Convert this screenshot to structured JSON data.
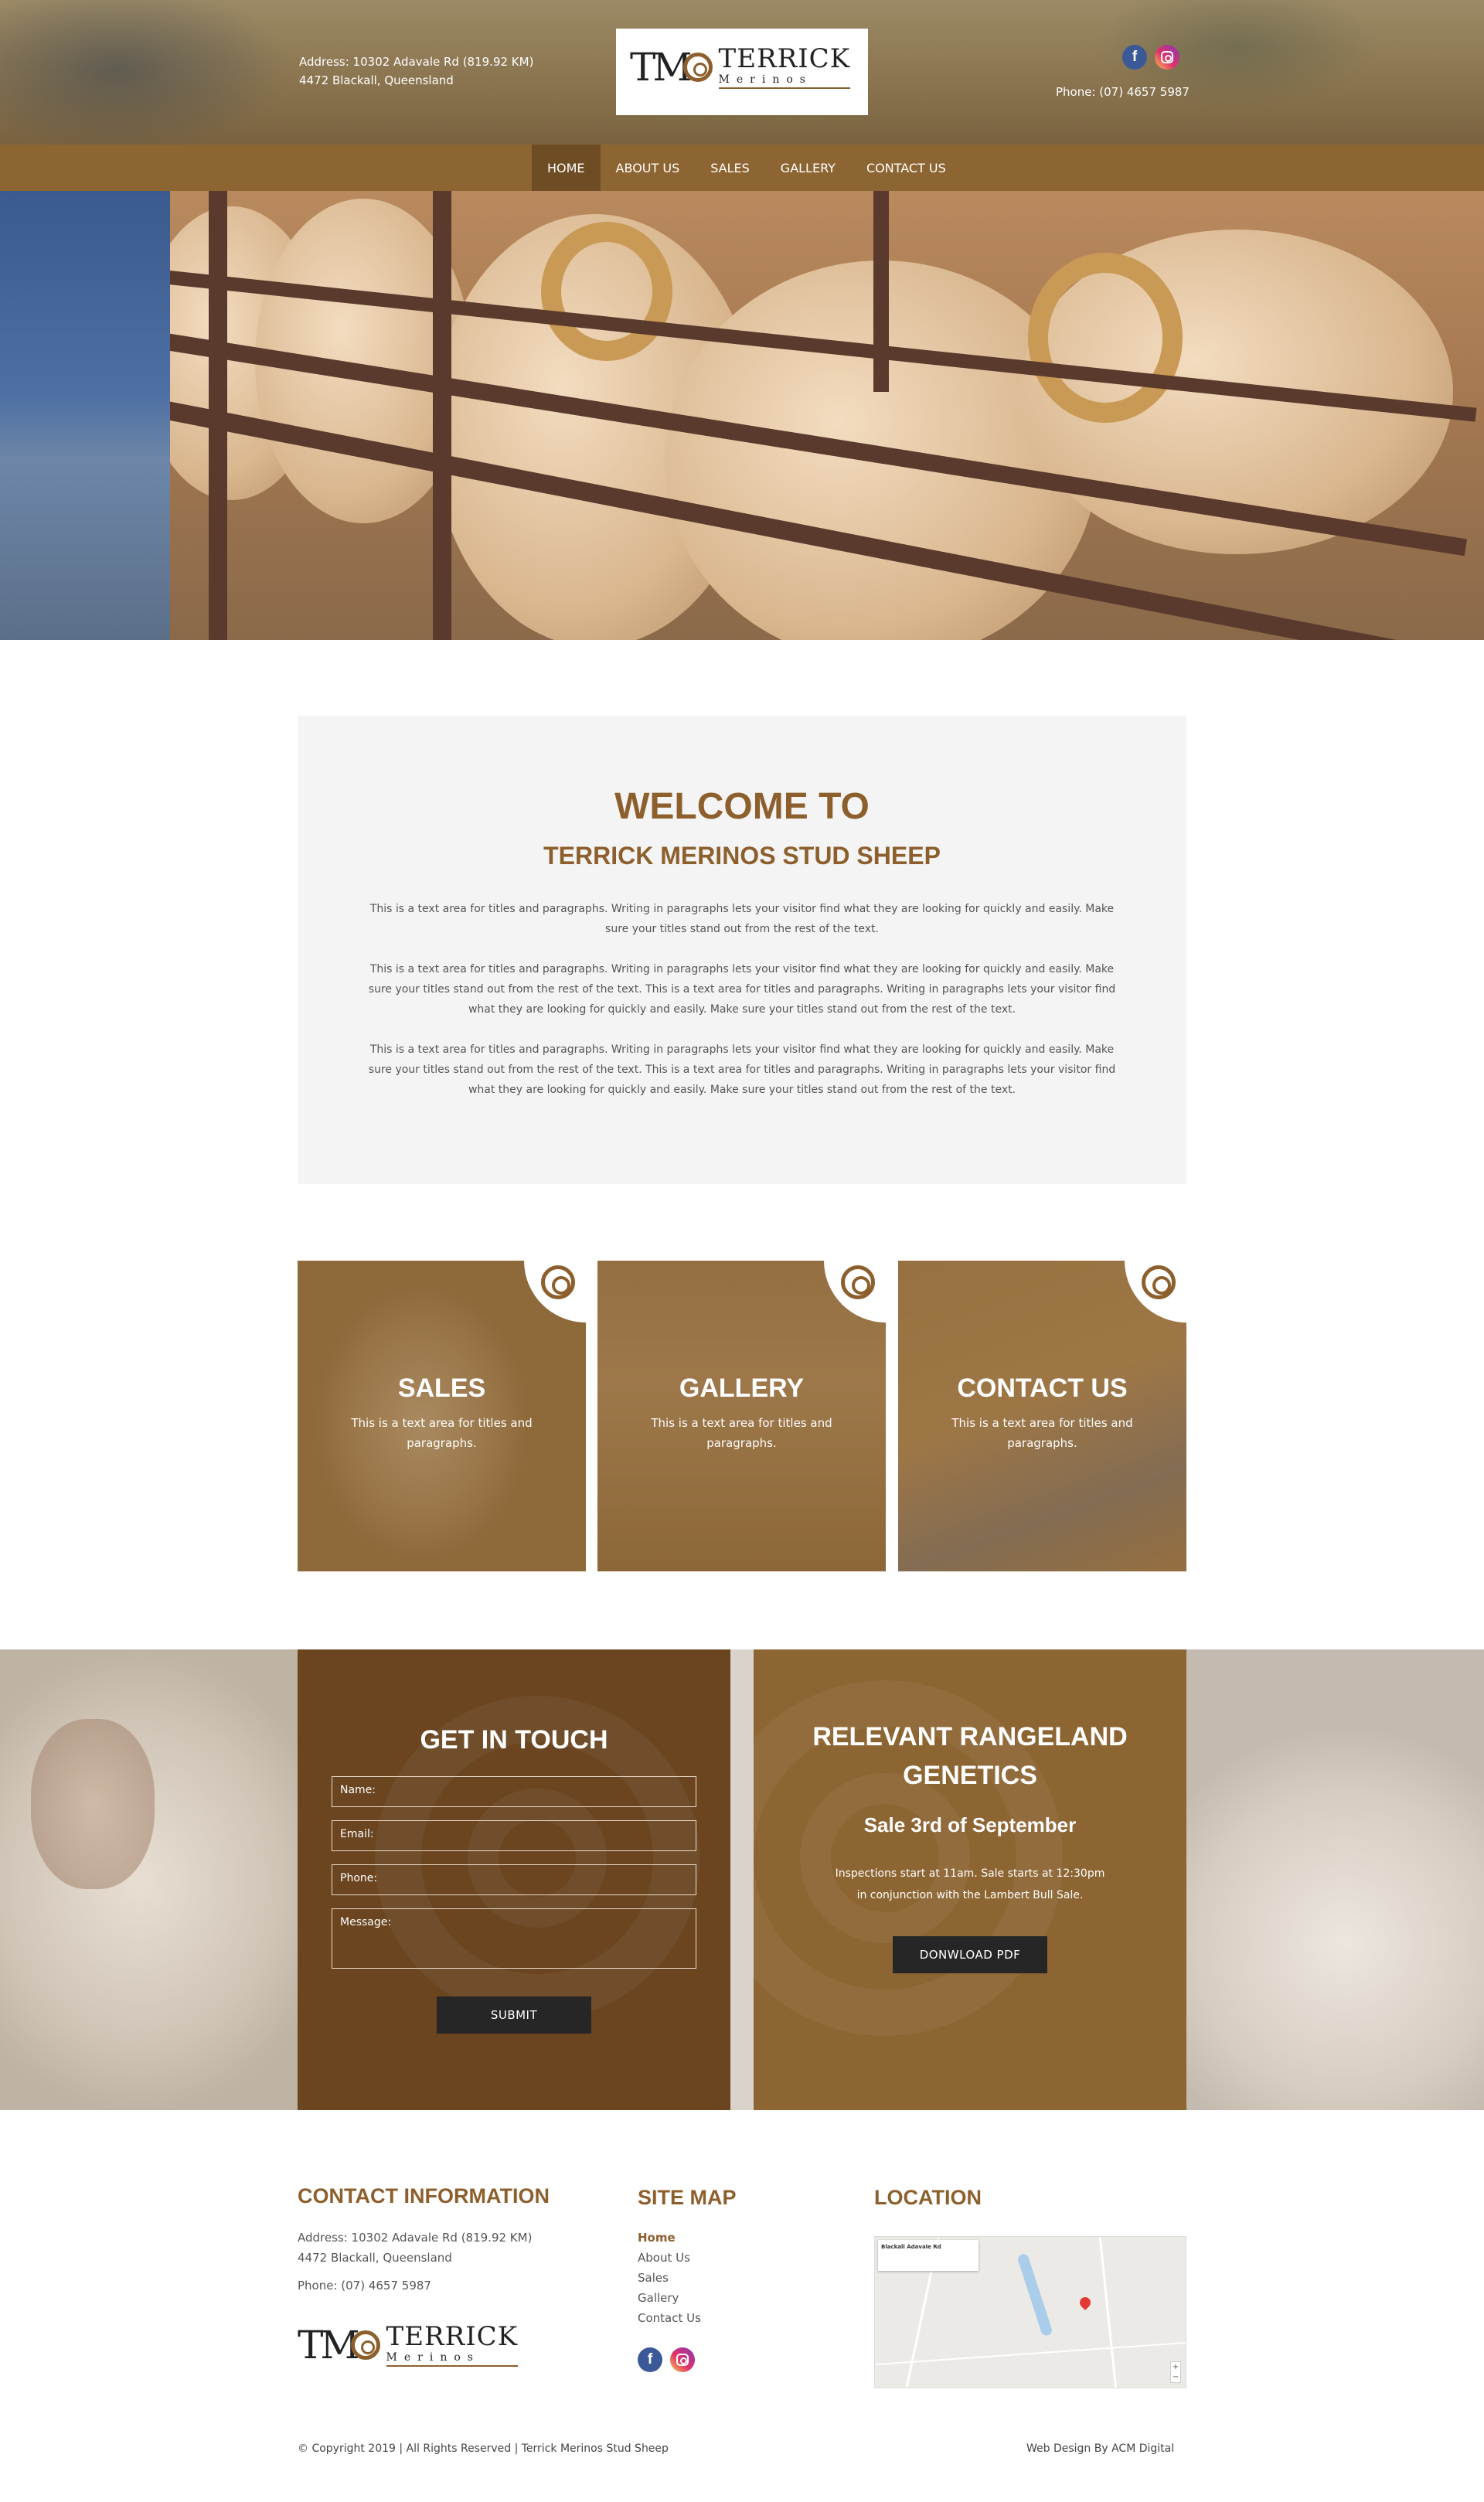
{
  "header": {
    "address_line1": "Address: 10302 Adavale Rd (819.92 KM)",
    "address_line2": "4472 Blackall, Queensland",
    "logo_mark": "TM",
    "logo_word1": "TERRICK",
    "logo_word2": "Merinos",
    "phone": "Phone: (07) 4657 5987",
    "social": [
      "facebook-icon",
      "instagram-icon"
    ]
  },
  "nav": {
    "items": [
      {
        "label": "HOME",
        "active": true
      },
      {
        "label": "ABOUT US"
      },
      {
        "label": "SALES"
      },
      {
        "label": "GALLERY"
      },
      {
        "label": "CONTACT US"
      }
    ]
  },
  "welcome": {
    "title": "WELCOME TO",
    "subtitle": "TERRICK MERINOS STUD SHEEP",
    "paragraphs": [
      "This is a text area for titles and paragraphs. Writing in paragraphs lets your visitor find what they are looking for quickly and easily. Make sure your titles stand out from the rest of the text.",
      "This is a text area for titles and paragraphs. Writing in paragraphs lets your visitor find what they are looking for quickly and easily. Make sure your titles stand out from the rest of the text. This is a text area for titles and paragraphs. Writing in paragraphs lets your visitor find what they are looking for quickly and easily. Make sure your titles stand out from the rest of the text.",
      "This is a text area for titles and paragraphs. Writing in paragraphs lets your visitor find what they are looking for quickly and easily. Make sure your titles stand out from the rest of the text. This is a text area for titles and paragraphs. Writing in paragraphs lets your visitor find what they are looking for quickly and easily. Make sure your titles stand out from the rest of the text."
    ]
  },
  "cards": [
    {
      "title": "SALES",
      "text": "This is a text area for titles and paragraphs."
    },
    {
      "title": "GALLERY",
      "text": "This is a text area for titles and paragraphs."
    },
    {
      "title": "CONTACT US",
      "text": "This is a text area for titles and paragraphs."
    }
  ],
  "contact_form": {
    "title": "GET IN TOUCH",
    "name_placeholder": "Name:",
    "email_placeholder": "Email:",
    "phone_placeholder": "Phone:",
    "message_placeholder": "Message:",
    "submit_label": "SUBMIT"
  },
  "genetics": {
    "title_line1": "RELEVANT RANGELAND",
    "title_line2": "GENETICS",
    "sale": "Sale 3rd of September",
    "note_line1": "Inspections start at 11am. Sale starts at 12:30pm",
    "note_line2": "in conjunction with the Lambert Bull Sale.",
    "button_label": "DONWLOAD PDF"
  },
  "footer": {
    "contact_title": "CONTACT INFORMATION",
    "address_line1": "Address: 10302 Adavale Rd (819.92 KM)",
    "address_line2": "4472 Blackall, Queensland",
    "phone": "Phone: (07) 4657 5987",
    "sitemap_title": "SITE MAP",
    "sitemap": [
      "Home",
      "About Us",
      "Sales",
      "Gallery",
      "Contact Us"
    ],
    "location_title": "LOCATION",
    "map_card_title": "Blackall Adavale Rd",
    "copyright": "© Copyright 2019 | All Rights Reserved | Terrick Merinos Stud Sheep",
    "credit": "Web Design By ACM Digital"
  },
  "colors": {
    "brand_brown": "#8d5f2d",
    "nav_bar": "#8d6532",
    "nav_active": "#6e4d24",
    "panel_dark": "#6a4520",
    "button_dark": "#262626",
    "welcome_bg": "#f4f4f4"
  }
}
